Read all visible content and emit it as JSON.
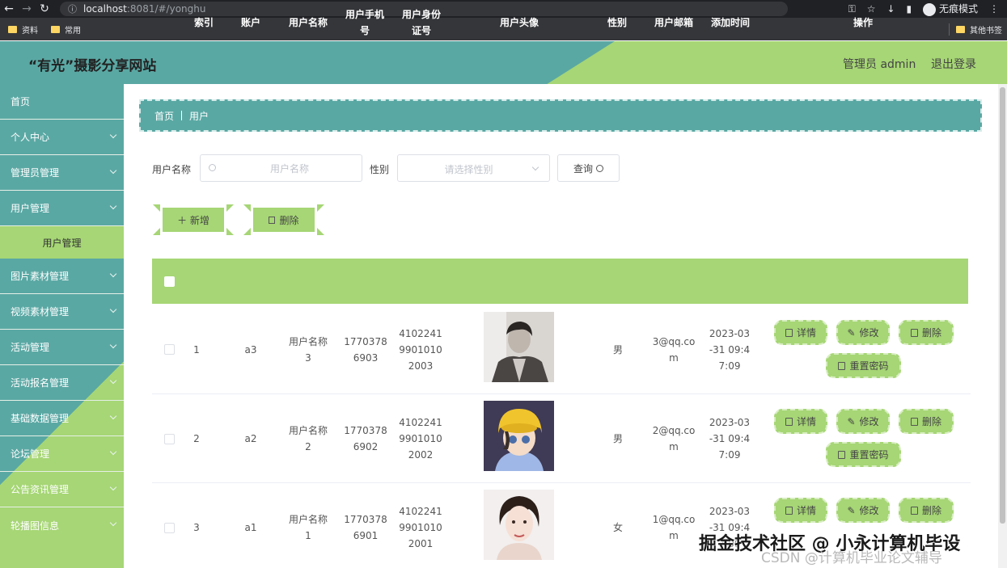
{
  "browser": {
    "url_host": "localhost",
    "url_rest": ":8081/#/yonghu",
    "incognito_label": "无痕模式",
    "bookmarks": [
      "资料",
      "常用"
    ],
    "other_bookmarks": "其他书签"
  },
  "header": {
    "title": "“有光”摄影分享网站",
    "admin_label": "管理员 admin",
    "logout": "退出登录"
  },
  "sidebar": {
    "items": [
      {
        "label": "首页"
      },
      {
        "label": "个人中心"
      },
      {
        "label": "管理员管理"
      },
      {
        "label": "用户管理"
      },
      {
        "label": "图片素材管理"
      },
      {
        "label": "视频素材管理"
      },
      {
        "label": "活动管理"
      },
      {
        "label": "活动报名管理"
      },
      {
        "label": "基础数据管理"
      },
      {
        "label": "论坛管理"
      },
      {
        "label": "公告资讯管理"
      },
      {
        "label": "轮播图信息"
      }
    ],
    "active_sub": "用户管理"
  },
  "breadcrumb": {
    "home": "首页",
    "current": "用户"
  },
  "search": {
    "name_label": "用户名称",
    "name_placeholder": "用户名称",
    "gender_label": "性别",
    "gender_placeholder": "请选择性别",
    "query_label": "查询"
  },
  "actions": {
    "add_label": "＋ 新增",
    "delete_label": "删除"
  },
  "table": {
    "headers": [
      "索引",
      "账户",
      "用户名称",
      "用户手机号",
      "用户身份证号",
      "用户头像",
      "性别",
      "用户邮箱",
      "添加时间",
      "操作"
    ],
    "header_lines": {
      "phone": [
        "用户手机",
        "号"
      ],
      "idcard": [
        "用户身份",
        "证号"
      ]
    },
    "rows": [
      {
        "index": "1",
        "account": "a3",
        "name": [
          "用户名称",
          "3"
        ],
        "phone": [
          "1770378",
          "6903"
        ],
        "idcard": [
          "4102241",
          "9901010",
          "2003"
        ],
        "gender": "男",
        "email": [
          "3@qq.co",
          "m"
        ],
        "time": [
          "2023-03",
          "-31 09:4",
          "7:09"
        ]
      },
      {
        "index": "2",
        "account": "a2",
        "name": [
          "用户名称",
          "2"
        ],
        "phone": [
          "1770378",
          "6902"
        ],
        "idcard": [
          "4102241",
          "9901010",
          "2002"
        ],
        "gender": "男",
        "email": [
          "2@qq.co",
          "m"
        ],
        "time": [
          "2023-03",
          "-31 09:4",
          "7:09"
        ]
      },
      {
        "index": "3",
        "account": "a1",
        "name": [
          "用户名称",
          "1"
        ],
        "phone": [
          "1770378",
          "6901"
        ],
        "idcard": [
          "4102241",
          "9901010",
          "2001"
        ],
        "gender": "女",
        "email": [
          "1@qq.co",
          "m"
        ],
        "time": [
          "2023-03",
          "-31 09:4",
          "7:09"
        ]
      }
    ],
    "op_labels": {
      "detail": "详情",
      "edit": "修改",
      "delete": "删除",
      "reset": "重置密码"
    }
  },
  "watermark": {
    "line1": "掘金技术社区 @ 小永计算机毕设",
    "line2": "CSDN @计算机毕业论文辅导"
  },
  "colors": {
    "teal": "#5aa8a4",
    "green": "#a6d675"
  }
}
